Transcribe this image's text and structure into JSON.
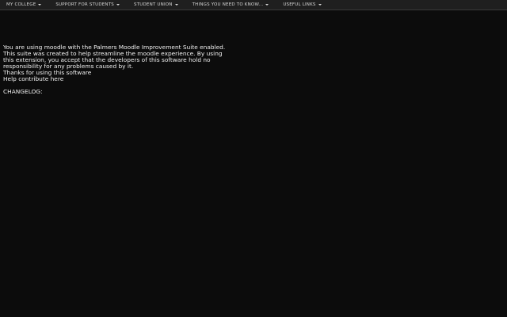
{
  "nav": {
    "items": [
      {
        "label": "MY COLLEGE"
      },
      {
        "label": "SUPPORT FOR STUDENTS"
      },
      {
        "label": "STUDENT UNION"
      },
      {
        "label": "THINGS YOU NEED TO KNOW..."
      },
      {
        "label": "USEFUL LINKS"
      }
    ]
  },
  "content": {
    "lines": [
      "You are using moodle with the Palmers Moodle Improvement Suite enabled.",
      "This suite was created to help streamline the moodle experience. By using",
      "this extension, you accept that the developers of this software hold no",
      "responsibility for any problems caused by it."
    ],
    "thanks": "Thanks for using this software",
    "contribute_link": "Help contribute here",
    "changelog_label": "CHANGELOG:"
  },
  "colors": {
    "background": "#0c0c0c",
    "nav_background": "#1f1f1f",
    "text": "#f0f0f0"
  }
}
